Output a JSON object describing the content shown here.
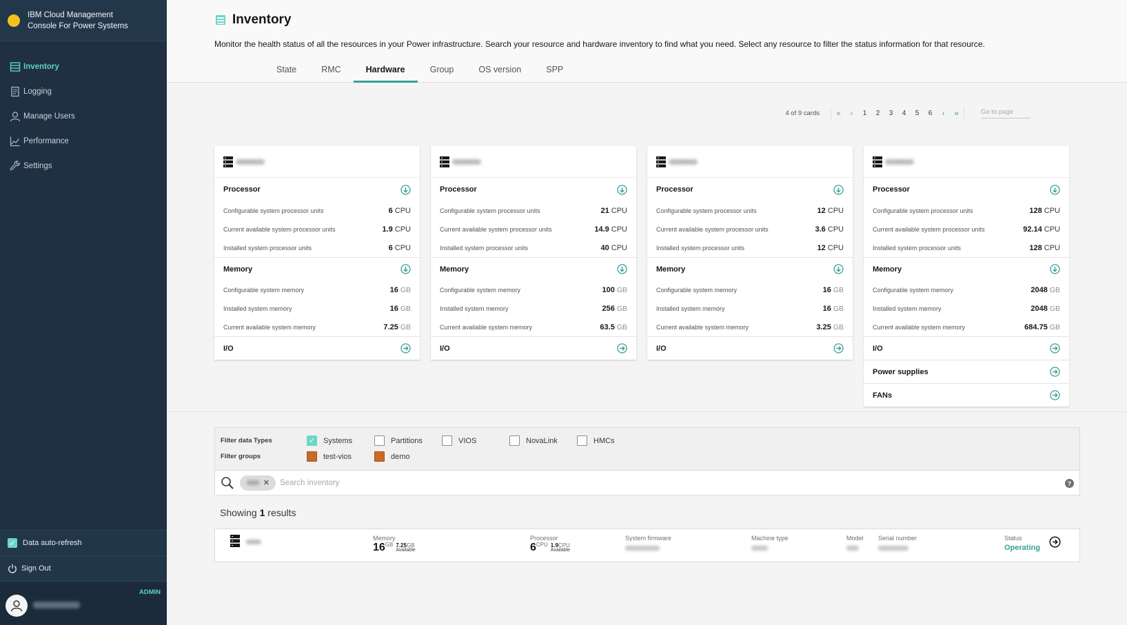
{
  "app": {
    "name": "IBM Cloud Management Console For Power Systems",
    "name_line1": "IBM Cloud Management",
    "name_line2": "Console For Power Systems"
  },
  "sidebar": {
    "items": [
      {
        "label": "Inventory",
        "icon": "inventory-icon",
        "active": true
      },
      {
        "label": "Logging",
        "icon": "logging-icon",
        "active": false
      },
      {
        "label": "Manage Users",
        "icon": "user-icon",
        "active": false
      },
      {
        "label": "Performance",
        "icon": "chart-icon",
        "active": false
      },
      {
        "label": "Settings",
        "icon": "wrench-icon",
        "active": false
      }
    ],
    "auto_refresh": {
      "label": "Data auto-refresh",
      "checked": true
    },
    "sign_out": "Sign Out",
    "role": "ADMIN"
  },
  "header": {
    "title": "Inventory",
    "description": "Monitor the health status of all the resources in your Power infrastructure. Search your resource and hardware inventory to find what you need. Select any resource to filter the status information for that resource.",
    "tabs": [
      {
        "label": "State",
        "active": false
      },
      {
        "label": "RMC",
        "active": false
      },
      {
        "label": "Hardware",
        "active": true
      },
      {
        "label": "Group",
        "active": false
      },
      {
        "label": "OS version",
        "active": false
      },
      {
        "label": "SPP",
        "active": false
      }
    ]
  },
  "pagination": {
    "count": "4 of 9 cards",
    "pages": [
      "1",
      "2",
      "3",
      "4",
      "5",
      "6"
    ],
    "goto_placeholder": "Go to page"
  },
  "cards": [
    {
      "processor": {
        "title": "Processor",
        "rows": [
          {
            "label": "Configurable system processor units",
            "value": "6",
            "unit": "CPU"
          },
          {
            "label": "Current available system processor units",
            "value": "1.9",
            "unit": "CPU"
          },
          {
            "label": "Installed system processor units",
            "value": "6",
            "unit": "CPU"
          }
        ]
      },
      "memory": {
        "title": "Memory",
        "rows": [
          {
            "label": "Configurable system memory",
            "value": "16",
            "unit": "GB"
          },
          {
            "label": "Installed system memory",
            "value": "16",
            "unit": "GB"
          },
          {
            "label": "Current available system memory",
            "value": "7.25",
            "unit": "GB"
          }
        ]
      },
      "io": "I/O"
    },
    {
      "processor": {
        "title": "Processor",
        "rows": [
          {
            "label": "Configurable system processor units",
            "value": "21",
            "unit": "CPU"
          },
          {
            "label": "Current available system processor units",
            "value": "14.9",
            "unit": "CPU"
          },
          {
            "label": "Installed system processor units",
            "value": "40",
            "unit": "CPU"
          }
        ]
      },
      "memory": {
        "title": "Memory",
        "rows": [
          {
            "label": "Configurable system memory",
            "value": "100",
            "unit": "GB"
          },
          {
            "label": "Installed system memory",
            "value": "256",
            "unit": "GB"
          },
          {
            "label": "Current available system memory",
            "value": "63.5",
            "unit": "GB"
          }
        ]
      },
      "io": "I/O"
    },
    {
      "processor": {
        "title": "Processor",
        "rows": [
          {
            "label": "Configurable system processor units",
            "value": "12",
            "unit": "CPU"
          },
          {
            "label": "Current available system processor units",
            "value": "3.6",
            "unit": "CPU"
          },
          {
            "label": "Installed system processor units",
            "value": "12",
            "unit": "CPU"
          }
        ]
      },
      "memory": {
        "title": "Memory",
        "rows": [
          {
            "label": "Configurable system memory",
            "value": "16",
            "unit": "GB"
          },
          {
            "label": "Installed system memory",
            "value": "16",
            "unit": "GB"
          },
          {
            "label": "Current available system memory",
            "value": "3.25",
            "unit": "GB"
          }
        ]
      },
      "io": "I/O"
    },
    {
      "processor": {
        "title": "Processor",
        "rows": [
          {
            "label": "Configurable system processor units",
            "value": "128",
            "unit": "CPU"
          },
          {
            "label": "Current available system processor units",
            "value": "92.14",
            "unit": "CPU"
          },
          {
            "label": "Installed system processor units",
            "value": "128",
            "unit": "CPU"
          }
        ]
      },
      "memory": {
        "title": "Memory",
        "rows": [
          {
            "label": "Configurable system memory",
            "value": "2048",
            "unit": "GB"
          },
          {
            "label": "Installed system memory",
            "value": "2048",
            "unit": "GB"
          },
          {
            "label": "Current available system memory",
            "value": "684.75",
            "unit": "GB"
          }
        ]
      },
      "io": "I/O",
      "power_supplies": "Power supplies",
      "fans": "FANs"
    }
  ],
  "filter": {
    "types_label": "Filter data Types",
    "types": [
      {
        "label": "Systems",
        "checked": true
      },
      {
        "label": "Partitions",
        "checked": false
      },
      {
        "label": "VIOS",
        "checked": false
      },
      {
        "label": "NovaLink",
        "checked": false
      },
      {
        "label": "HMCs",
        "checked": false
      }
    ],
    "groups_label": "Filter groups",
    "groups": [
      {
        "label": "test-vios",
        "color": "#c96a26"
      },
      {
        "label": "demo",
        "color": "#c96a26"
      }
    ],
    "search_placeholder": "Search inventory"
  },
  "results": {
    "prefix": "Showing",
    "count": "1",
    "suffix": "results"
  },
  "result_row": {
    "memory_label": "Memory",
    "memory_total": "16",
    "memory_total_unit": "GB",
    "memory_avail": "7.25",
    "memory_avail_unit": "GB",
    "available_label": "Available",
    "processor_label": "Processor",
    "processor_total": "6",
    "processor_total_unit": "CPU",
    "processor_avail": "1.9",
    "processor_avail_unit": "CPU",
    "firmware_label": "System firmware",
    "machine_type_label": "Machine type",
    "model_label": "Model",
    "serial_label": "Serial number",
    "status_label": "Status",
    "status_value": "Operating"
  },
  "colors": {
    "accent": "#3a9e98",
    "sidebar_bg": "#1f3042",
    "brand_dot": "#f1c21b"
  }
}
